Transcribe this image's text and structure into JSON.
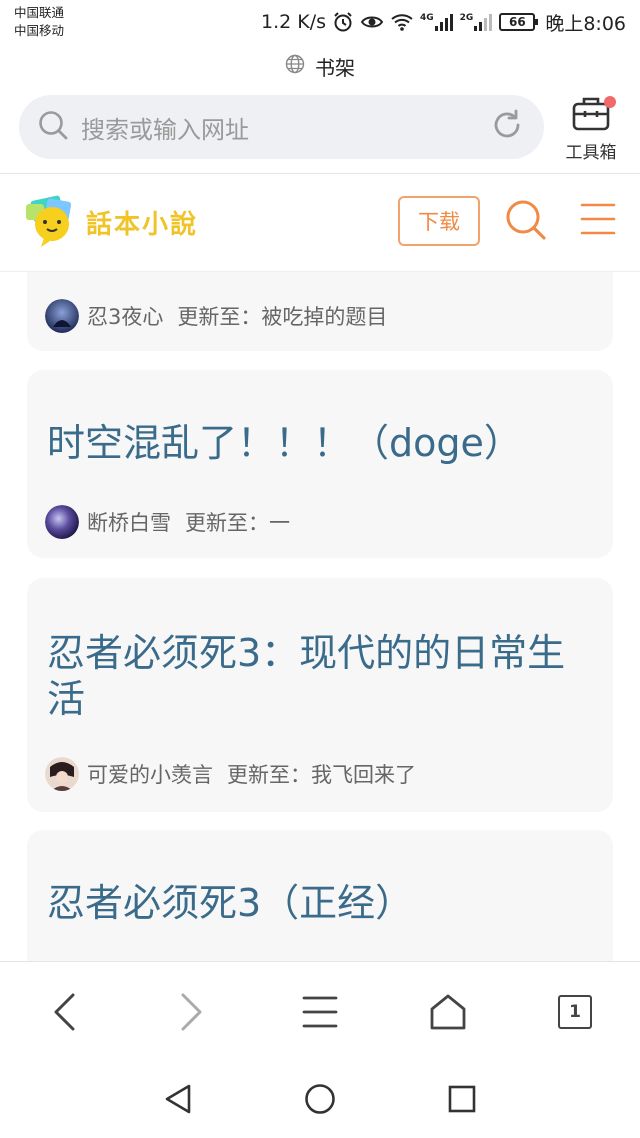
{
  "status": {
    "carrier1": "中国联通",
    "carrier2": "中国移动",
    "speed": "1.2 K/s",
    "net1": "4G",
    "net2": "2G",
    "battery": "66",
    "time": "晚上8:06"
  },
  "browser": {
    "page_title": "书架",
    "search_placeholder": "搜索或输入网址",
    "toolbox_label": "工具箱"
  },
  "site": {
    "logo_text": "話本小說",
    "download_label": "下载"
  },
  "cards": [
    {
      "author": "忍3夜心",
      "update": "更新至：被吃掉的题目"
    },
    {
      "title": "时空混乱了！！！（doge）",
      "author": "断桥白雪",
      "update": "更新至：一"
    },
    {
      "title": "忍者必须死3：现代的的日常生活",
      "author": "可爱的小羡言",
      "update": "更新至：我飞回来了"
    },
    {
      "title": "忍者必须死3（正经）"
    }
  ],
  "bottom_nav": {
    "tab_count": "1"
  }
}
